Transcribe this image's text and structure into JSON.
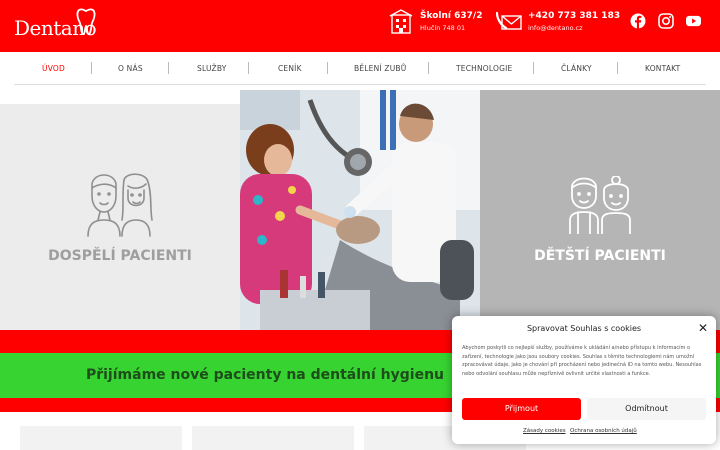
{
  "header": {
    "logo_text": "Dentano",
    "address": {
      "line1": "Školní 637/2",
      "line2": "Hlučín 748 01"
    },
    "contact": {
      "phone": "+420 773 381 183",
      "email": "info@dentano.cz"
    },
    "social": [
      "facebook-icon",
      "instagram-icon",
      "youtube-icon"
    ]
  },
  "colors": {
    "brand_red": "#fe0000",
    "green": "#37d431",
    "dark_green_text": "#1d4d1a",
    "grey_panel": "#b5b5b5"
  },
  "nav": {
    "items": [
      {
        "label": "Úvod",
        "active": true
      },
      {
        "label": "O nás"
      },
      {
        "label": "Služby"
      },
      {
        "label": "Ceník"
      },
      {
        "label": "Bělení zubů"
      },
      {
        "label": "Technologie"
      },
      {
        "label": "Články"
      },
      {
        "label": "Kontakt"
      }
    ]
  },
  "hero": {
    "left_title": "DOSPĚLÍ PACIENTI",
    "right_title": "DĚTŠTÍ PACIENTI"
  },
  "banner": {
    "text": "Přijímáme nové pacienty na dentální hygienu"
  },
  "cookie": {
    "title": "Spravovat Souhlas s cookies",
    "body": "Abychom poskytli co nejlepší služby, používáme k ukládání a/nebo přístupu k informacím o zařízení, technologie jako jsou soubory cookies. Souhlas s těmito technologiemi nám umožní zpracovávat údaje, jako je chování při procházení nebo jedinečná ID na tomto webu. Nesouhlas nebo odvolání souhlasu může nepříznivě ovlivnit určité vlastnosti a funkce.",
    "accept": "Přijmout",
    "deny": "Odmítnout",
    "link1": "Zásady cookies",
    "link2": "Ochrana osobních údajů"
  }
}
